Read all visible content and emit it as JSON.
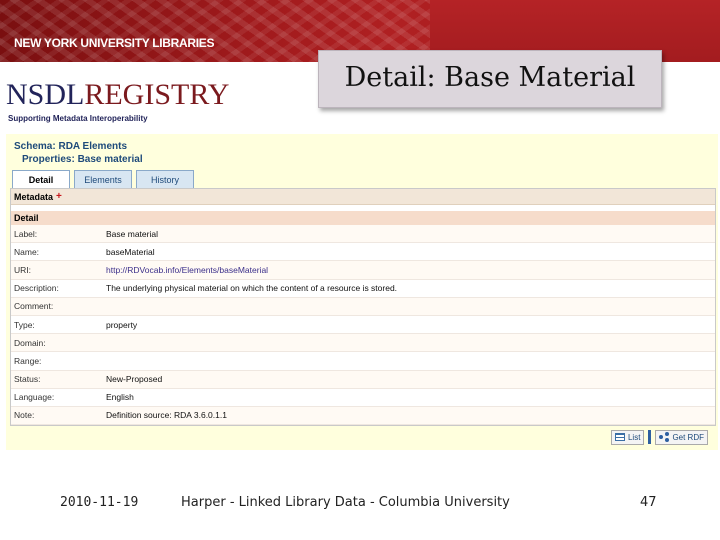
{
  "banner": {
    "org": "NEW YORK UNIVERSITY LIBRARIES"
  },
  "slide_title": "Detail: Base Material",
  "logo": {
    "nsdl": "NSDL",
    "registry": "REGISTRY",
    "tagline": "Supporting Metadata Interoperability"
  },
  "schema": {
    "schema_label": "Schema:",
    "schema_value": "RDA Elements",
    "properties_label": "Properties:",
    "properties_value": "Base material"
  },
  "tabs": [
    {
      "label": "Detail",
      "active": true
    },
    {
      "label": "Elements",
      "active": false
    },
    {
      "label": "History",
      "active": false
    }
  ],
  "metadata_header": "Metadata",
  "metadata_plus": "+",
  "detail_header": "Detail",
  "fields": [
    {
      "key": "Label:",
      "value": "Base material"
    },
    {
      "key": "Name:",
      "value": "baseMaterial"
    },
    {
      "key": "URI:",
      "value": "http://RDVocab.info/Elements/baseMaterial"
    },
    {
      "key": "Description:",
      "value": "The underlying physical material on which the content of a resource is stored."
    },
    {
      "key": "Comment:",
      "value": ""
    },
    {
      "key": "Type:",
      "value": "property"
    },
    {
      "key": "Domain:",
      "value": ""
    },
    {
      "key": "Range:",
      "value": ""
    },
    {
      "key": "Status:",
      "value": "New-Proposed"
    },
    {
      "key": "Language:",
      "value": "English"
    },
    {
      "key": "Note:",
      "value": "Definition source: RDA 3.6.0.1.1"
    }
  ],
  "actions": {
    "list_label": "List",
    "rdf_label": "Get RDF"
  },
  "footer": {
    "date": "2010-11-19",
    "center": "Harper - Linked Library Data - Columbia University",
    "page": "47"
  }
}
